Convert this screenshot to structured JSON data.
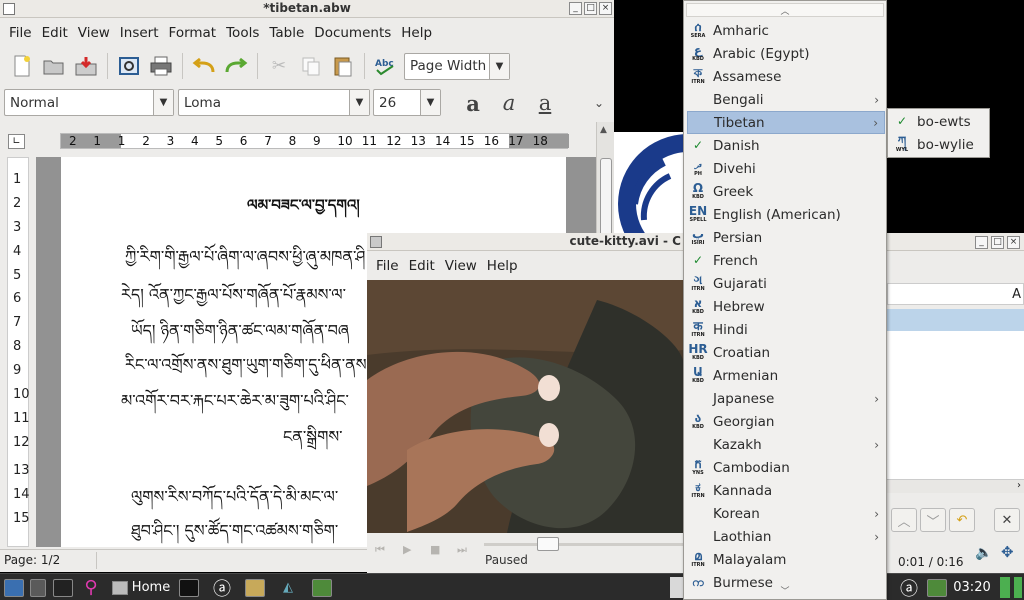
{
  "abiword": {
    "title": "*tibetan.abw",
    "menu": [
      "File",
      "Edit",
      "View",
      "Insert",
      "Format",
      "Tools",
      "Table",
      "Documents",
      "Help"
    ],
    "zoom": "Page Width",
    "style": "Normal",
    "font": "Loma",
    "size": "26",
    "ruler_numbers": [
      "2",
      "1",
      "1",
      "2",
      "3",
      "4",
      "5",
      "6",
      "7",
      "8",
      "9",
      "10",
      "11",
      "12",
      "13",
      "14",
      "15",
      "16",
      "17",
      "18"
    ],
    "line_numbers": [
      "1",
      "2",
      "3",
      "4",
      "5",
      "6",
      "7",
      "8",
      "9",
      "10",
      "11",
      "12",
      "13",
      "14",
      "15"
    ],
    "doc_title": "ལམ་བཟང་ལ་བྱ་དགའ།",
    "doc_lines": [
      "ཀྱི་རིག་གི་རྒྱལ་པོ་ཞིག་ལ་ཞབས་ཕྱི་ཞུ་མཁན་ཤི",
      "རེད།  འོན་ཀྱང་རྒྱལ་པོས་གཞོན་པོ་རྣམས་ལ་",
      "ཡོད།  ཉིན་གཅིག་ཉིན་ཚང་ལམ་གཞོན་བཞ",
      "རིང་ལ་འགྲོས་ནས་ཐུག་ཡུག་གཅིག་དུ་ཕིན་ནས",
      "མ་འགོར་བར་རྐང་པར་ཆེར་མ་ཟུག་པའི་ཤིང་",
      "ངན་སྒྲིགས་",
      "ལུགས་རིས་བཀོད་པའི་དོན་དེ་མི་མང་ལ་",
      "ཐུབ་ཤིང་།  དུས་ཚོད་གང་འཚམས་གཅིག་"
    ],
    "status": "Page: 1/2"
  },
  "video": {
    "title": "cute-kitty.avi - C",
    "menu": [
      "File",
      "Edit",
      "View",
      "Help"
    ],
    "status": "Paused",
    "progress": 0.0625
  },
  "rightwin": {
    "time": "0:01 /  0:16",
    "partial": "A"
  },
  "taskbar": {
    "home": "Home",
    "clock": "03:20"
  },
  "langmenu": {
    "items": [
      {
        "label": "Amharic",
        "icon": "ሰ",
        "tag": "SERA",
        "sub": false
      },
      {
        "label": "Arabic (Egypt)",
        "icon": "ع",
        "tag": "KBD",
        "sub": false
      },
      {
        "label": "Assamese",
        "icon": "ক",
        "tag": "ITRN",
        "sub": false
      },
      {
        "label": "Bengali",
        "icon": "",
        "tag": "",
        "sub": true
      },
      {
        "label": "Tibetan",
        "icon": "",
        "tag": "",
        "sub": true,
        "selected": true
      },
      {
        "label": "Danish",
        "icon": "✓",
        "tag": "",
        "sub": false,
        "spell": true
      },
      {
        "label": "Divehi",
        "icon": "ދ",
        "tag": "PH",
        "sub": false
      },
      {
        "label": "Greek",
        "icon": "Ω",
        "tag": "KBD",
        "sub": false
      },
      {
        "label": "English (American)",
        "icon": "EN",
        "tag": "SPELL",
        "sub": false
      },
      {
        "label": "Persian",
        "icon": "پ",
        "tag": "ISIRI",
        "sub": false
      },
      {
        "label": "French",
        "icon": "✓",
        "tag": "",
        "sub": false,
        "spell": true
      },
      {
        "label": "Gujarati",
        "icon": "ગ",
        "tag": "ITRN",
        "sub": false
      },
      {
        "label": "Hebrew",
        "icon": "א",
        "tag": "KBD",
        "sub": false
      },
      {
        "label": "Hindi",
        "icon": "क",
        "tag": "ITRN",
        "sub": false
      },
      {
        "label": "Croatian",
        "icon": "HR",
        "tag": "KBD",
        "sub": false
      },
      {
        "label": "Armenian",
        "icon": "Ա",
        "tag": "KBD",
        "sub": false
      },
      {
        "label": "Japanese",
        "icon": "",
        "tag": "",
        "sub": true
      },
      {
        "label": "Georgian",
        "icon": "ა",
        "tag": "KBD",
        "sub": false
      },
      {
        "label": "Kazakh",
        "icon": "",
        "tag": "",
        "sub": true
      },
      {
        "label": "Cambodian",
        "icon": "ក",
        "tag": "YNS",
        "sub": false
      },
      {
        "label": "Kannada",
        "icon": "ಕ",
        "tag": "ITRN",
        "sub": false
      },
      {
        "label": "Korean",
        "icon": "",
        "tag": "",
        "sub": true
      },
      {
        "label": "Laothian",
        "icon": "",
        "tag": "",
        "sub": true
      },
      {
        "label": "Malayalam",
        "icon": "മ",
        "tag": "ITRN",
        "sub": false
      },
      {
        "label": "Burmese",
        "icon": "က",
        "tag": "",
        "sub": false
      }
    ]
  },
  "submenu": {
    "items": [
      {
        "label": "bo-ewts",
        "icon": "✓"
      },
      {
        "label": "bo-wylie",
        "icon": "ཀ",
        "tag": "WYL"
      }
    ]
  }
}
